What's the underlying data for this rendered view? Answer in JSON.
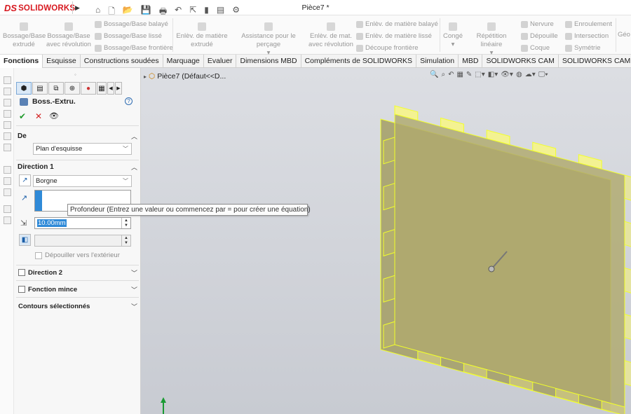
{
  "app": {
    "logo_ds": "DS",
    "logo_name": "SOLIDWORKS",
    "document_title": "Pièce7 *"
  },
  "quick_access": [
    {
      "name": "home-icon",
      "glyph": "⌂"
    },
    {
      "name": "new-icon",
      "glyph": "🗋"
    },
    {
      "name": "open-icon",
      "glyph": "📂"
    },
    {
      "name": "save-icon",
      "glyph": "💾"
    },
    {
      "name": "print-icon",
      "glyph": "🖶"
    },
    {
      "name": "undo-icon",
      "glyph": "↶"
    },
    {
      "name": "select-icon",
      "glyph": "⇱"
    },
    {
      "name": "rebuild-icon",
      "glyph": "▮"
    },
    {
      "name": "file-properties-icon",
      "glyph": "▤"
    },
    {
      "name": "options-icon",
      "glyph": "⚙"
    }
  ],
  "ribbon": {
    "boss_extrude": [
      "Bossage/Base",
      "extrudé"
    ],
    "boss_revolve": [
      "Bossage/Base",
      "avec révolution"
    ],
    "boss_sweep": "Bossage/Base balayé",
    "boss_loft": "Bossage/Base lissé",
    "boss_boundary": "Bossage/Base frontière",
    "cut_extrude": [
      "Enlèv. de matière",
      "extrudé"
    ],
    "hole_wizard": "Assistance pour le perçage",
    "cut_revolve": [
      "Enlèv. de mat.",
      "avec révolution"
    ],
    "cut_sweep": "Enlèv. de matière balayé",
    "cut_loft": "Enlèv. de matière lissé",
    "cut_boundary": "Découpe frontière",
    "fillet": "Congé",
    "linear_pattern": "Répétition linéaire",
    "rib": "Nervure",
    "draft": "Dépouille",
    "shell": "Coque",
    "wrap": "Enroulement",
    "intersect": "Intersection",
    "mirror": "Symétrie",
    "geometry_ref": "Géo"
  },
  "tabs": [
    "Fonctions",
    "Esquisse",
    "Constructions soudées",
    "Marquage",
    "Evaluer",
    "Dimensions MBD",
    "Compléments de SOLIDWORKS",
    "Simulation",
    "MBD",
    "SOLIDWORKS CAM",
    "SOLIDWORKS CAM TBM"
  ],
  "feature_tree": {
    "item": "Pièce7  (Défaut<<D..."
  },
  "property_manager": {
    "title": "Boss.-Extru.",
    "help": "?",
    "ok": "✔",
    "cancel": "✕",
    "preview": "👁",
    "from_section": {
      "title": "De",
      "start_condition": "Plan d'esquisse"
    },
    "direction1": {
      "title": "Direction 1",
      "end_condition": "Borgne",
      "depth": "10.00mm",
      "draft_outward": "Dépouiller vers l'extérieur"
    },
    "direction2": {
      "title": "Direction 2"
    },
    "thin_feature": {
      "title": "Fonction mince"
    },
    "selected_contours": {
      "title": "Contours sélectionnés"
    }
  },
  "tooltip": "Profondeur (Entrez une valeur ou commencez par = pour créer une équation)",
  "colors": {
    "accent": "#d71920",
    "part_fill": "#b0aa6e",
    "part_edge": "#f2ff2a",
    "selection_blue": "#2f8ad8"
  }
}
